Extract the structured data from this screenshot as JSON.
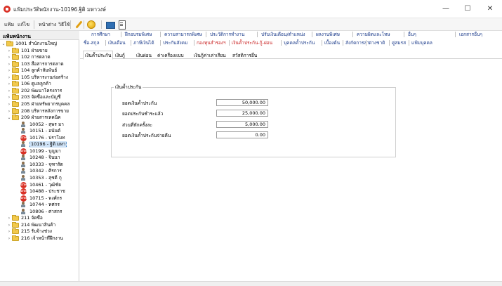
{
  "window": {
    "title": "แฟ้มประวัติพนักงาน-10196.ฐิติ มหาวงษ์",
    "minimize_glyph": "—",
    "maximize_glyph": "☐",
    "close_glyph": "✕"
  },
  "menubar": {
    "items": [
      "แฟ้ม",
      "แก้ไข",
      "หน้าต่าง",
      "วิธีใช้"
    ]
  },
  "sidebar": {
    "header": "แฟ้มพนักงาน",
    "tree": [
      {
        "label": "1001 สำนักงานใหญ่",
        "icon": "folder-icon",
        "chev": "⌄"
      },
      {
        "label": "101 ฝ่ายขาย",
        "icon": "folder-icon",
        "chev": "›"
      },
      {
        "label": "102 การตลาด",
        "icon": "folder-icon",
        "chev": "›"
      },
      {
        "label": "103 สื่อสารการตลาด",
        "icon": "folder-icon",
        "chev": "›"
      },
      {
        "label": "104 ลูกค้าสัมพันธ์",
        "icon": "folder-icon",
        "chev": "›"
      },
      {
        "label": "105 บริหารงานก่อสร้าง",
        "icon": "folder-icon",
        "chev": "›"
      },
      {
        "label": "106 ดูแลลูกค้า",
        "icon": "folder-icon",
        "chev": "›"
      },
      {
        "label": "202 พัฒนาโครงการ",
        "icon": "folder-icon",
        "chev": "›"
      },
      {
        "label": "203 จัดซื้อและบัญชี",
        "icon": "folder-icon",
        "chev": "›"
      },
      {
        "label": "205 ฝ่ายทรัพยากรบุคคล",
        "icon": "folder-icon",
        "chev": "›"
      },
      {
        "label": "208 บริหารหลังการขาย",
        "icon": "folder-icon",
        "chev": "›"
      },
      {
        "label": "209 ฝ่ายสารเทคนิค",
        "icon": "folder-icon",
        "chev": "⌄"
      },
      {
        "label": "10052 - สุพร มา",
        "icon": "person-icon",
        "chev": ""
      },
      {
        "label": "10151 - อนันต์",
        "icon": "person-icon",
        "chev": ""
      },
      {
        "label": "10176 - ปราโมท",
        "icon": "stop-icon",
        "chev": ""
      },
      {
        "label": "10196 - ฐิติ มหา",
        "icon": "person-icon",
        "chev": "",
        "selected": true
      },
      {
        "label": "10199 - บุญมา",
        "icon": "stop-icon",
        "chev": ""
      },
      {
        "label": "10248 - จินนา",
        "icon": "person-icon",
        "chev": ""
      },
      {
        "label": "10333 - จุฑารัต",
        "icon": "person-icon",
        "chev": ""
      },
      {
        "label": "10342 - ศิรการ",
        "icon": "person-icon",
        "chev": ""
      },
      {
        "label": "10353 - สุชดี กุ",
        "icon": "person-icon",
        "chev": ""
      },
      {
        "label": "10461 - วุฒิชัย",
        "icon": "stop-icon",
        "chev": ""
      },
      {
        "label": "10488 - ประชาช",
        "icon": "stop-icon",
        "chev": ""
      },
      {
        "label": "10715 - พงศ์กร",
        "icon": "stop-icon",
        "chev": ""
      },
      {
        "label": "10744 - ทศกร",
        "icon": "person-icon",
        "chev": ""
      },
      {
        "label": "10806 - ศาสกร",
        "icon": "person-icon",
        "chev": ""
      },
      {
        "label": "211 จัดซื้อ",
        "icon": "folder-icon",
        "chev": "›"
      },
      {
        "label": "214 พัฒนาสินค้า",
        "icon": "folder-icon",
        "chev": "›"
      },
      {
        "label": "215 รับจ้างช่วง",
        "icon": "folder-icon",
        "chev": "›"
      },
      {
        "label": "216 เจ้าหน้าที่ฝึกงาน",
        "icon": "folder-icon",
        "chev": "›"
      }
    ],
    "stop_badge_text": "STOP"
  },
  "tabs_row1": [
    "การศึกษา",
    "ฝึกอบรมพิเศษ",
    "ความสามารถพิเศษ",
    "ประวัติการทำงาน",
    "ปรับเงินเดือน/ตำแหน่ง",
    "ผลงานพิเศษ",
    "ความผิดและโทษ",
    "อื่นๆ",
    "เอกสารอื่นๆ"
  ],
  "tabs_row2": [
    "ชื่อ-สกุล",
    "เงินเดือน",
    "ภาษีเงินได้",
    "ประกันสังคม",
    "กองทุนสำรองฯ",
    "เงินค้ำประกัน-กู้-ผ่อน",
    "บุคคลค้ำประกัน",
    "เบื้องต้น",
    "สังกัดการลา",
    "ต่างชาติ",
    "คู่สมรส",
    "แฟ้มบุคคล"
  ],
  "subtabs": [
    "เงินค้ำประกัน",
    "เงินกู้",
    "เงินผ่อน",
    "ค่าเครื่องแบบ",
    "เงินกู้ค่าเล่าเรียน",
    "สวัสดิการอื่น"
  ],
  "guarantee": {
    "group_title": "เงินค้ำประกัน",
    "fields": [
      {
        "label": "ยอดเงินค้ำประกัน",
        "value": "50,000.00"
      },
      {
        "label": "ยอดประกันชำระแล้ว",
        "value": "25,000.00"
      },
      {
        "label": "ส่วนที่หักครั้งละ",
        "value": "5,000.00"
      },
      {
        "label": "ยอดเงินค้ำประกันจ่ายคืน",
        "value": "0.00"
      }
    ]
  },
  "colors": {
    "tab_blue": "#1a3a8a",
    "tab_red": "#c81e1e",
    "stop_red": "#d93025",
    "folder_yellow": "#f2c94c"
  }
}
